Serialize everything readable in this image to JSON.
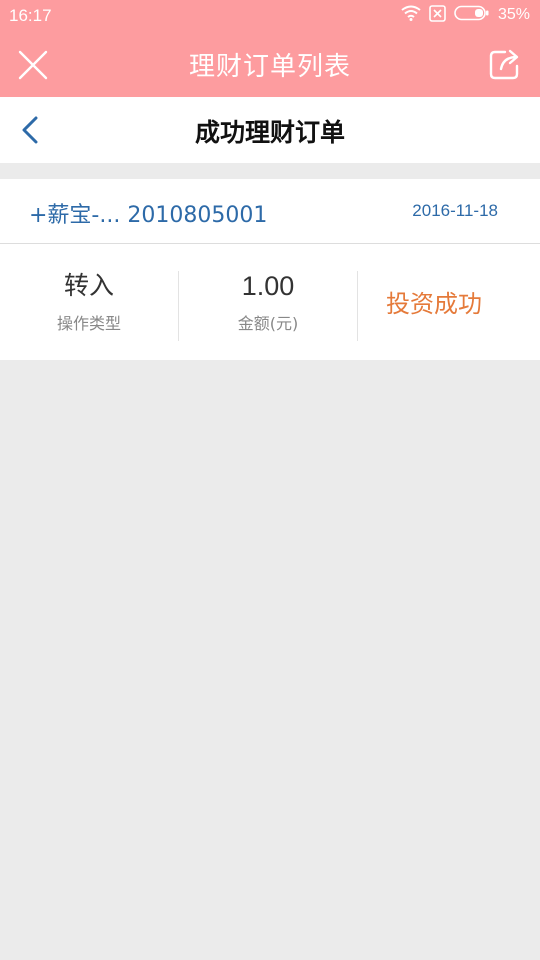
{
  "status_bar": {
    "time": "16:17",
    "battery": "35%"
  },
  "header": {
    "title": "理财订单列表"
  },
  "sub_header": {
    "title": "成功理财订单"
  },
  "order": {
    "name": "+薪宝-... 2010805001",
    "date": "2016-11-18",
    "type_value": "转入",
    "type_label": "操作类型",
    "amount_value": "1.00",
    "amount_label": "金额(元)",
    "status": "投资成功"
  },
  "colors": {
    "header_bg": "#fd9c9f",
    "link_blue": "#2d6aa8",
    "status_orange": "#e57a3a",
    "page_bg": "#ebebeb"
  }
}
